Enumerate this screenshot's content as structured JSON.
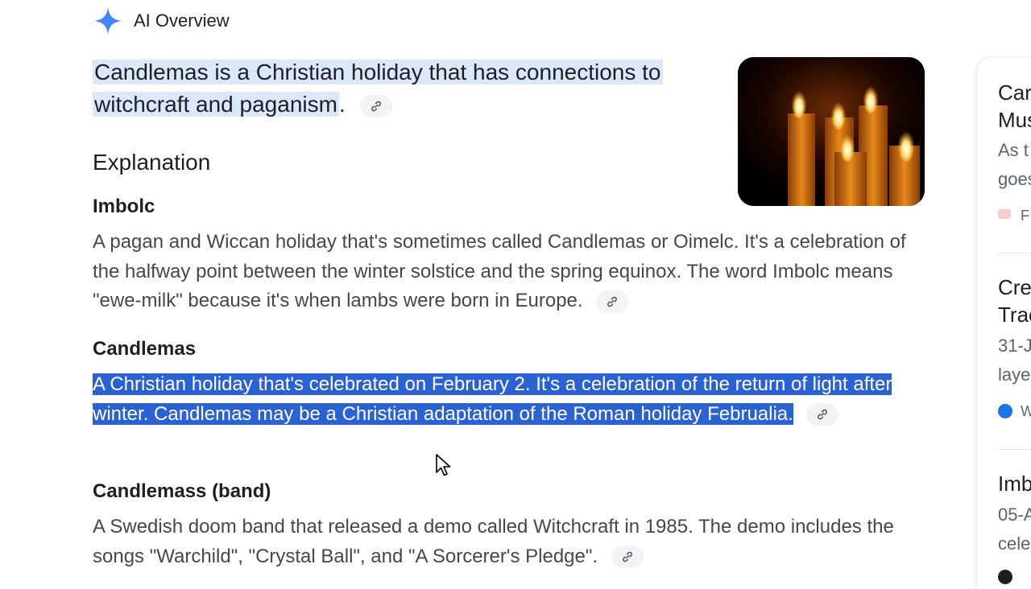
{
  "header": {
    "title": "AI Overview",
    "icon": "sparkle-icon",
    "accent": "#1a73e8"
  },
  "summary": {
    "text": "Candlemas is a Christian holiday that has connections to witchcraft and paganism",
    "period": "."
  },
  "explanation_heading": "Explanation",
  "items": [
    {
      "heading": "Imbolc",
      "text": "A pagan and Wiccan holiday that's sometimes called Candlemas or Oimelc. It's a celebration of the halfway point between the winter solstice and the spring equinox. The word Imbolc means \"ewe-milk\" because it's when lambs were born in Europe."
    },
    {
      "heading": "Candlemas",
      "text": "A Christian holiday that's celebrated on February 2. It's a celebration of the return of light after winter. Candlemas may be a Christian adaptation of the Roman holiday Februalia.",
      "selected": true,
      "selection_color": "#2b62d3"
    },
    {
      "heading": "Candlemass (band)",
      "text": "A Swedish doom band that released a demo called Witchcraft in 1985. The demo includes the songs \"Warchild\", \"Crystal Ball\", and \"A Sorcerer's Pledge\"."
    }
  ],
  "image": {
    "alt": "candles-image"
  },
  "sidebar": {
    "cards": [
      {
        "title_lines": [
          "Car",
          "Mus"
        ],
        "body_lines": [
          "As t",
          "goes"
        ],
        "source": "F"
      },
      {
        "title_lines": [
          "Cre",
          "Trac"
        ],
        "body_lines": [
          "31-J",
          "laye"
        ],
        "source": "W"
      },
      {
        "title_lines": [
          "Imb"
        ],
        "body_lines": [
          "05-A",
          "cele"
        ],
        "source": ""
      }
    ]
  }
}
